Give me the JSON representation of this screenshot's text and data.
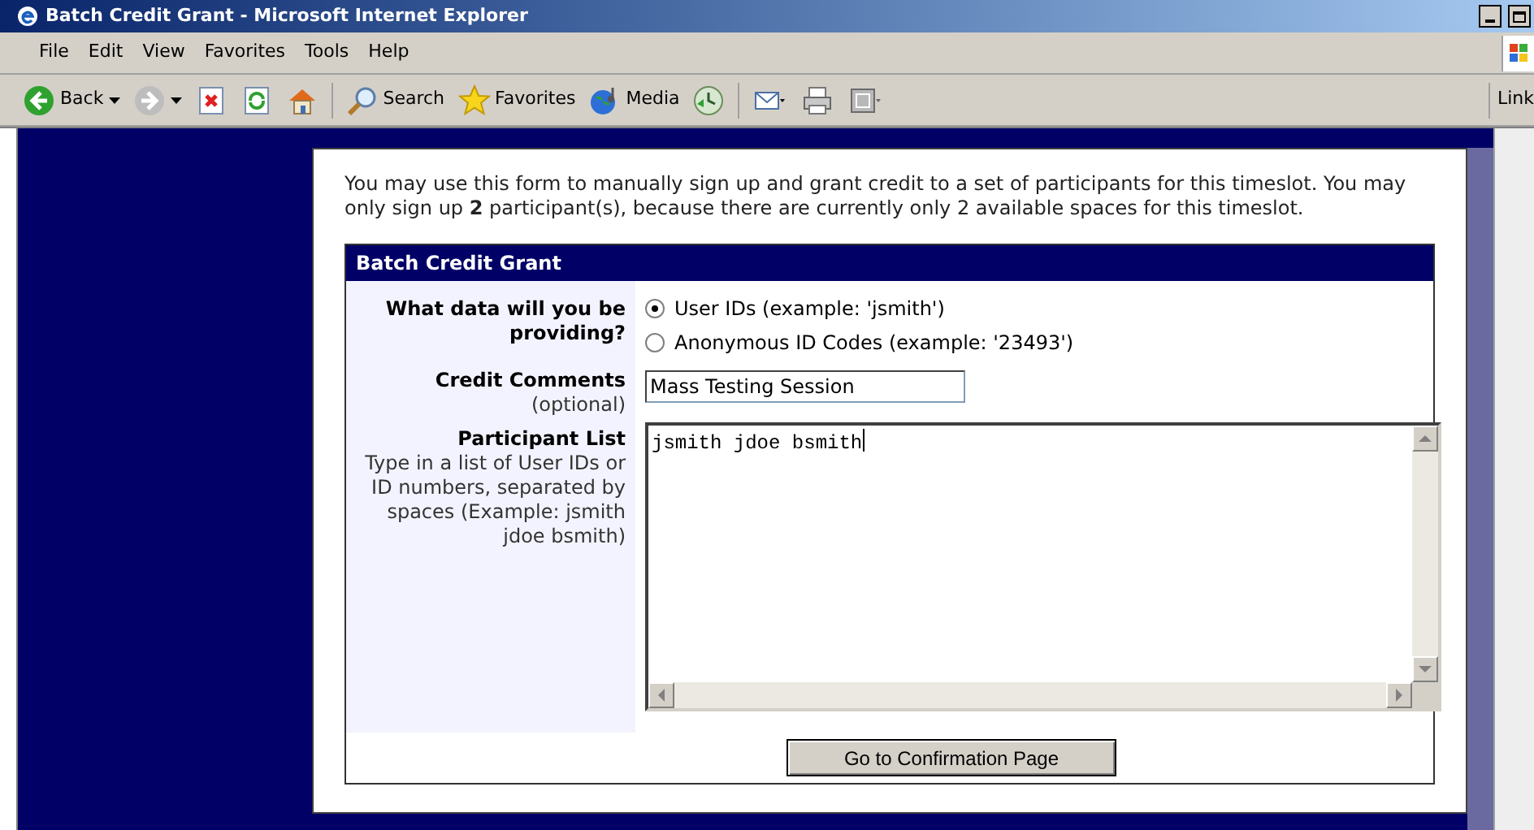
{
  "window": {
    "title": "Batch Credit Grant - Microsoft Internet Explorer"
  },
  "menu": [
    "File",
    "Edit",
    "View",
    "Favorites",
    "Tools",
    "Help"
  ],
  "toolbar": [
    {
      "kind": "back",
      "label": "Back"
    },
    {
      "kind": "forward"
    },
    {
      "kind": "stop"
    },
    {
      "kind": "refresh"
    },
    {
      "kind": "home"
    },
    {
      "kind": "search",
      "label": "Search"
    },
    {
      "kind": "favorites",
      "label": "Favorites"
    },
    {
      "kind": "media",
      "label": "Media"
    },
    {
      "kind": "history"
    },
    {
      "kind": "mail"
    },
    {
      "kind": "print"
    },
    {
      "kind": "page"
    }
  ],
  "links_label": "Link",
  "intro": "You may use this form to manually sign up and grant credit to a set of participants for this timeslot. You may only sign up **2** participant(s), because there are currently only 2 available spaces for this timeslot.",
  "form": {
    "title": "Batch Credit Grant",
    "data_question": "What data will you be providing?",
    "options": [
      {
        "label": "User IDs (example: 'jsmith')",
        "selected": true
      },
      {
        "label": "Anonymous ID Codes (example: '23493')",
        "selected": false
      }
    ],
    "comments_label": "Credit Comments",
    "comments_hint": "(optional)",
    "comments_value": "Mass Testing Session",
    "list_label": "Participant List",
    "list_hint": "Type in a list of User IDs or ID numbers, separated by spaces (Example: jsmith jdoe bsmith)",
    "list_value": "jsmith jdoe bsmith",
    "submit": "Go to Confirmation Page"
  }
}
